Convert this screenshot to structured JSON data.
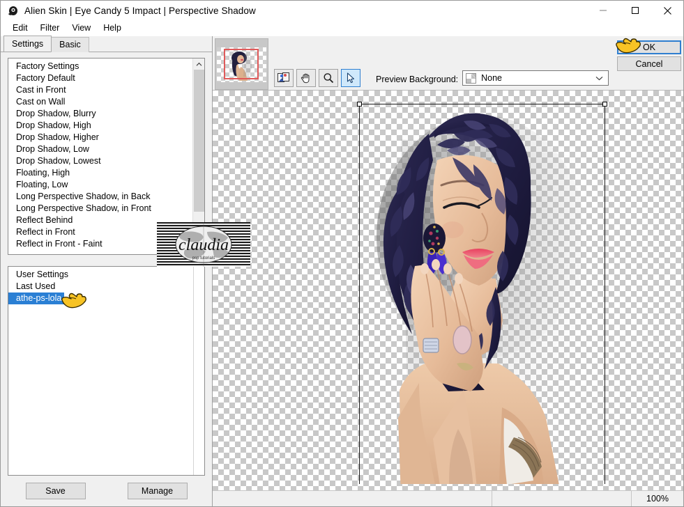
{
  "window": {
    "title": "Alien Skin | Eye Candy 5 Impact | Perspective Shadow",
    "icon": "app-eye-icon",
    "minimize_label": "—",
    "maximize_label": "□",
    "close_label": "✕"
  },
  "menubar": {
    "items": [
      {
        "label": "Edit"
      },
      {
        "label": "Filter"
      },
      {
        "label": "View"
      },
      {
        "label": "Help"
      }
    ]
  },
  "tabs": [
    {
      "label": "Settings",
      "active": true
    },
    {
      "label": "Basic",
      "active": false
    }
  ],
  "factory_settings": {
    "items": [
      "Factory Settings",
      "Factory Default",
      "Cast in Front",
      "Cast on Wall",
      "Drop Shadow, Blurry",
      "Drop Shadow, High",
      "Drop Shadow, Higher",
      "Drop Shadow, Low",
      "Drop Shadow, Lowest",
      "Floating, High",
      "Floating, Low",
      "Long Perspective Shadow, in Back",
      "Long Perspective Shadow, in Front",
      "Reflect Behind",
      "Reflect in Front",
      "Reflect in Front - Faint"
    ],
    "scroll_up_icon": "chevron-up-icon",
    "scroll_down_icon": "chevron-down-icon"
  },
  "user_settings": {
    "items": [
      {
        "label": "User Settings",
        "selected": false
      },
      {
        "label": "Last Used",
        "selected": false
      },
      {
        "label": "athe-ps-lola",
        "selected": true
      }
    ]
  },
  "left_buttons": {
    "save_label": "Save",
    "manage_label": "Manage"
  },
  "toolbar": {
    "navigator_name": "navigator-thumbnail",
    "tools": [
      {
        "name": "before-after-compare-icon",
        "active": false
      },
      {
        "name": "hand-pan-icon",
        "active": false
      },
      {
        "name": "zoom-magnifier-icon",
        "active": false
      },
      {
        "name": "arrow-select-icon",
        "active": true
      }
    ],
    "preview_background_label": "Preview Background:",
    "preview_background_value": "None",
    "dropdown_icon": "chevron-down-icon"
  },
  "dialog_buttons": {
    "ok_label": "OK",
    "cancel_label": "Cancel"
  },
  "statusbar": {
    "zoom_level": "100%"
  },
  "watermark": {
    "text": "claudia",
    "subtext": "psp tutorials"
  },
  "colors": {
    "accent": "#2f7fd0",
    "selection": "#2a7fd4",
    "window_bg": "#f0f0f0",
    "listbox_bg": "#ffffff",
    "button_face": "#e1e1e1",
    "viewport_rect": "#e05a5a"
  }
}
